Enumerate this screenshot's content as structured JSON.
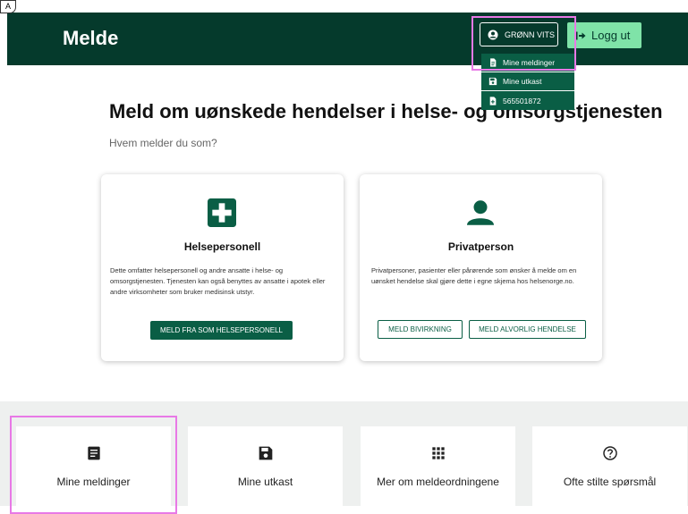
{
  "corner_badge": "A",
  "header": {
    "brand": "Melde",
    "user_label": "GRØNN VITS",
    "logout_label": "Logg ut"
  },
  "dropdown": {
    "items": [
      {
        "label": "Mine meldinger",
        "icon": "document-icon"
      },
      {
        "label": "Mine utkast",
        "icon": "save-icon"
      },
      {
        "label": "565501872",
        "icon": "document-add-icon"
      }
    ]
  },
  "main": {
    "title": "Meld om uønskede hendelser i helse- og omsorgstjenesten",
    "subtitle": "Hvem melder du som?",
    "cards": [
      {
        "title": "Helsepersonell",
        "icon": "medical-cross-icon",
        "description": "Dette omfatter helsepersonell og andre ansatte i helse- og omsorgstjenesten. Tjenesten kan også benyttes av ansatte i apotek eller andre virksomheter som bruker medisinsk utstyr.",
        "button": "MELD FRA SOM HELSEPERSONELL"
      },
      {
        "title": "Privatperson",
        "icon": "person-icon",
        "description": "Privatpersoner, pasienter eller pårørende som ønsker å melde om en uønsket hendelse skal gjøre dette i egne skjema hos helsenorge.no.",
        "button_1": "MELD BIVIRKNING",
        "button_2": "MELD ALVORLIG HENDELSE"
      }
    ]
  },
  "bottom": {
    "tiles": [
      {
        "label": "Mine meldinger",
        "icon": "document-icon"
      },
      {
        "label": "Mine utkast",
        "icon": "save-icon"
      },
      {
        "label": "Mer om meldeordningene",
        "icon": "grid-icon"
      },
      {
        "label": "Ofte stilte spørsmål",
        "icon": "help-circle-icon"
      }
    ]
  },
  "colors": {
    "header_bg": "#053a2c",
    "primary": "#0a5e45",
    "logout_bg": "#7fe3a8",
    "highlight": "#e879e6"
  }
}
